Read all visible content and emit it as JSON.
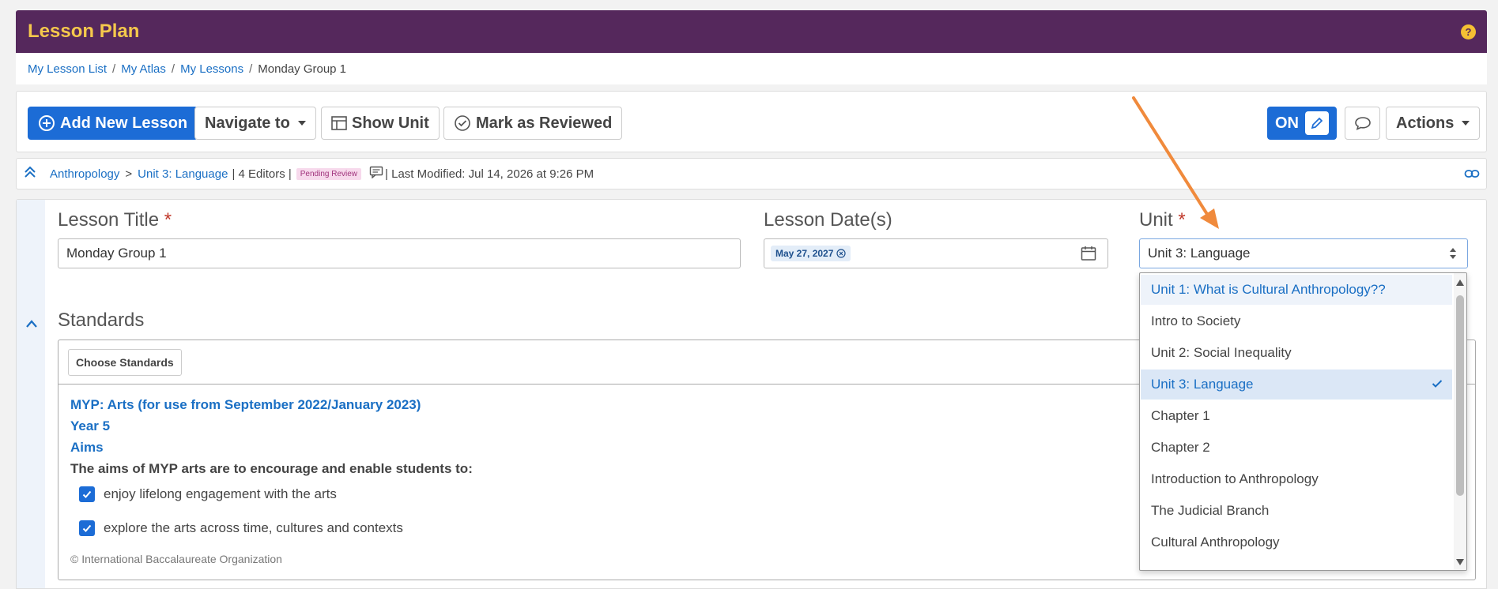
{
  "header": {
    "title": "Lesson Plan",
    "help": "?"
  },
  "breadcrumb": {
    "items": [
      "My Lesson List",
      "My Atlas",
      "My Lessons"
    ],
    "current": "Monday Group 1",
    "sep": "/"
  },
  "toolbar": {
    "add_lesson": "Add New Lesson",
    "navigate": "Navigate to",
    "show_unit": "Show Unit",
    "mark_reviewed": "Mark as Reviewed",
    "toggle": "ON",
    "actions": "Actions"
  },
  "info": {
    "course": "Anthropology",
    "gt": ">",
    "unit": "Unit 3: Language",
    "editors": "| 4 Editors |",
    "badge": "Pending Review",
    "modified": "| Last Modified: Jul 14, 2026 at 9:26 PM"
  },
  "form": {
    "title_label": "Lesson Title",
    "title_value": "Monday Group 1",
    "date_label": "Lesson Date(s)",
    "date_chip": "May 27, 2027",
    "unit_label": "Unit",
    "unit_value": "Unit 3: Language",
    "required": "*"
  },
  "standards": {
    "heading": "Standards",
    "choose": "Choose Standards",
    "framework": "MYP: Arts (for use from September 2022/January 2023)",
    "year": "Year 5",
    "aims": "Aims",
    "intro": "The aims of MYP arts are to encourage and enable students to:",
    "items": [
      "enjoy lifelong engagement with the arts",
      "explore the arts across time, cultures and contexts"
    ],
    "copyright": "© International Baccalaureate Organization"
  },
  "dropdown": {
    "options": [
      "Unit 1: What is Cultural Anthropology??",
      "Intro to Society",
      "Unit 2: Social Inequality",
      "Unit 3: Language",
      "Chapter 1",
      "Chapter 2",
      "Introduction to Anthropology",
      "The Judicial Branch",
      "Cultural Anthropology"
    ],
    "selected": "Unit 3: Language",
    "highlighted": "Unit 1: What is Cultural Anthropology??"
  },
  "colors": {
    "header_bg": "#55285c",
    "title": "#f5c84c",
    "primary": "#1c6cd6",
    "link": "#1a6fc4",
    "arrow": "#f08a3c"
  }
}
